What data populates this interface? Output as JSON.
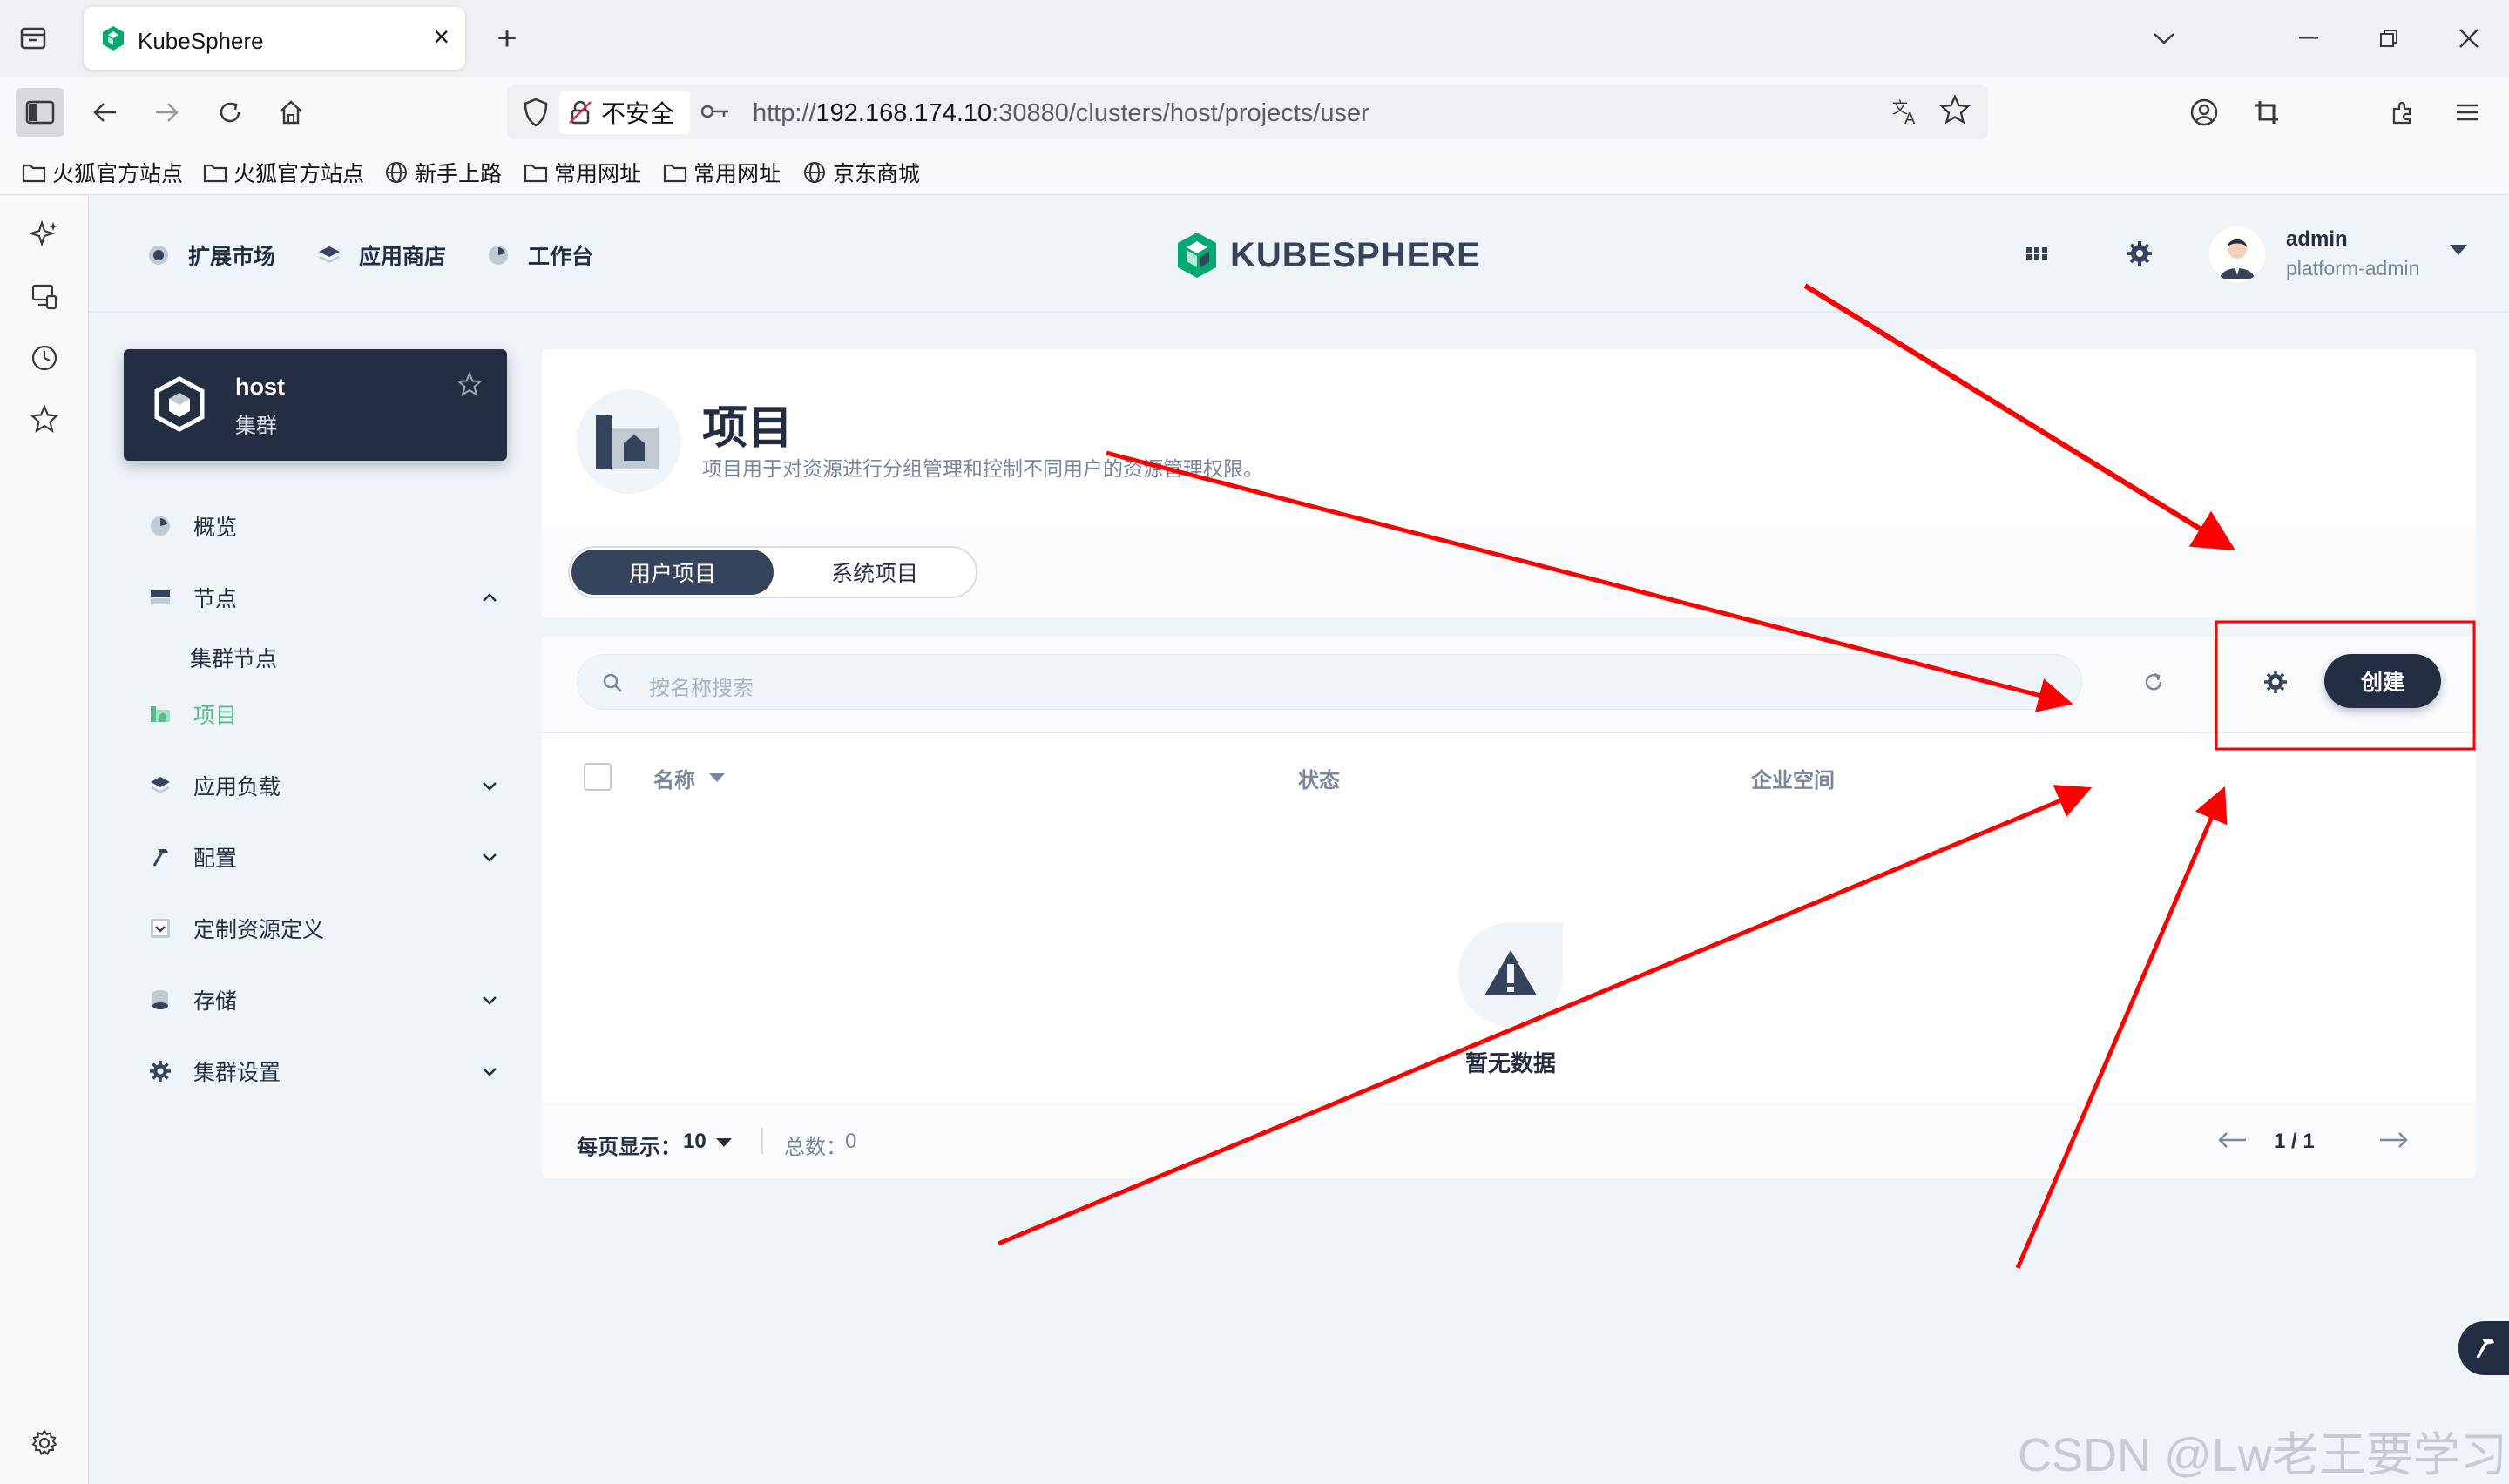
{
  "browser": {
    "tab_title": "KubeSphere",
    "new_tab": "+",
    "security_label": "不安全",
    "url_prefix": "http://",
    "url_host": "192.168.174.10",
    "url_rest": ":30880/clusters/host/projects/user",
    "bookmarks": [
      "火狐官方站点",
      "火狐官方站点",
      "新手上路",
      "常用网址",
      "常用网址",
      "京东商城"
    ]
  },
  "topbar": {
    "nav": [
      "扩展市场",
      "应用商店",
      "工作台"
    ],
    "logo_text": "KUBESPHERE",
    "user_name": "admin",
    "user_role": "platform-admin"
  },
  "cluster": {
    "name": "host",
    "type": "集群"
  },
  "menu": {
    "overview": "概览",
    "nodes": "节点",
    "cluster_nodes": "集群节点",
    "projects": "项目",
    "workloads": "应用负载",
    "config": "配置",
    "crd": "定制资源定义",
    "storage": "存储",
    "cluster_settings": "集群设置"
  },
  "page": {
    "title": "项目",
    "description": "项目用于对资源进行分组管理和控制不同用户的资源管理权限。",
    "tabs": [
      "用户项目",
      "系统项目"
    ],
    "search_placeholder": "按名称搜索",
    "create_label": "创建",
    "columns": [
      "名称",
      "状态",
      "企业空间"
    ],
    "empty_text": "暂无数据",
    "per_page_label": "每页显示：",
    "per_page_value": "10",
    "total_label": "总数：",
    "total_value": "0",
    "page_indicator": "1 / 1"
  },
  "colors": {
    "dark": "#242e42",
    "green": "#55bc8a",
    "annotation_red": "#ff0000"
  },
  "watermark": "CSDN @Lw老王要学习"
}
